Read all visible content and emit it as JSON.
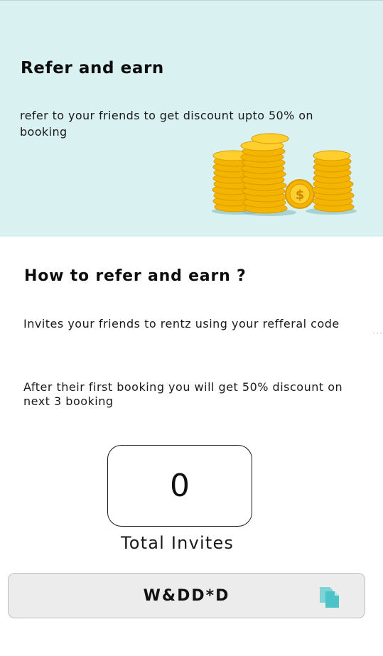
{
  "hero": {
    "title": "Refer and earn",
    "description": "refer to your friends to get discount upto 50% on booking",
    "illustration": "gold-coin-stacks",
    "background_color": "#daf1f1"
  },
  "how_to": {
    "title": "How to refer and earn ?",
    "step1": "Invites your friends to rentz using your refferal code",
    "step2": "After their first booking you will get 50% discount on next 3 booking"
  },
  "invites": {
    "count": "0",
    "label": "Total Invites"
  },
  "referral": {
    "code": "W&DD*D",
    "copy_icon": "copy-icon",
    "icon_color": "#4cc3c8"
  }
}
